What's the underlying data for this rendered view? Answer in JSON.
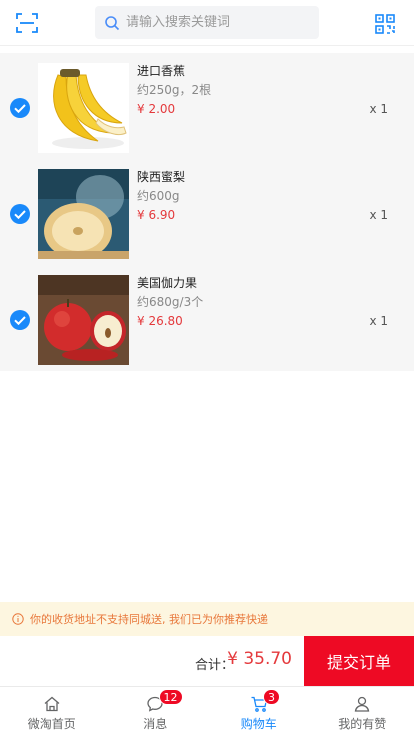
{
  "header": {
    "scan_icon": "scan-icon",
    "search_placeholder": "请输入搜索关键词",
    "qr_icon": "qrcode-icon"
  },
  "cart": {
    "items": [
      {
        "name": "进口香蕉",
        "spec": "约250g，2根",
        "price": "¥ 2.00",
        "qty": "x 1",
        "checked": true,
        "image": "banana"
      },
      {
        "name": "陕西蜜梨",
        "spec": "约600g",
        "price": "¥ 6.90",
        "qty": "x 1",
        "checked": true,
        "image": "pear"
      },
      {
        "name": "美国伽力果",
        "spec": "约680g/3个",
        "price": "¥ 26.80",
        "qty": "x 1",
        "checked": true,
        "image": "apple"
      }
    ]
  },
  "notice": {
    "text": "你的收货地址不支持同城送, 我们已为你推荐快递"
  },
  "submit": {
    "total_label": "合计：",
    "total_amount": "¥ 35.70",
    "button_label": "提交订单"
  },
  "tabbar": {
    "tabs": [
      {
        "label": "微淘首页",
        "icon": "home-icon",
        "badge": "",
        "active": false
      },
      {
        "label": "消息",
        "icon": "chat-icon",
        "badge": "12",
        "active": false
      },
      {
        "label": "购物车",
        "icon": "cart-icon",
        "badge": "3",
        "active": true
      },
      {
        "label": "我的有赞",
        "icon": "user-icon",
        "badge": "",
        "active": false
      }
    ]
  },
  "colors": {
    "accent": "#1989fa",
    "price": "#e4393c",
    "submit": "#ee0a24",
    "notice_bg": "#fdf6e0",
    "notice_text": "#e8773a"
  }
}
